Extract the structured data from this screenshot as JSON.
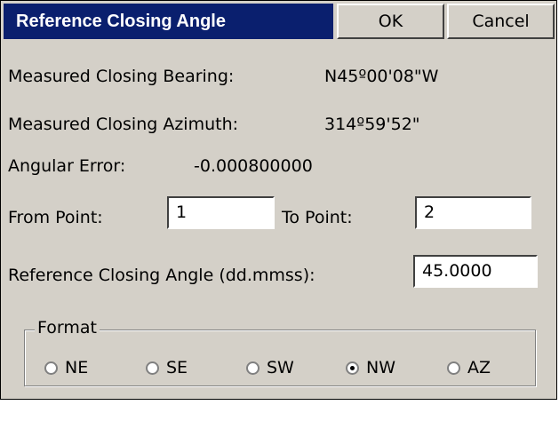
{
  "dialog": {
    "title": "Reference Closing Angle",
    "ok_label": "OK",
    "cancel_label": "Cancel"
  },
  "measured_bearing": {
    "label": "Measured Closing Bearing:",
    "value": "N45º00'08\"W"
  },
  "measured_azimuth": {
    "label": "Measured Closing Azimuth:",
    "value": "314º59'52\""
  },
  "angular_error": {
    "label": "Angular Error:",
    "value": "-0.000800000"
  },
  "from_point": {
    "label": "From Point:",
    "value": "1"
  },
  "to_point": {
    "label": "To Point:",
    "value": "2"
  },
  "reference_angle": {
    "label": "Reference Closing Angle (dd.mmss):",
    "value": "45.0000"
  },
  "format": {
    "legend": "Format",
    "options": [
      {
        "label": "NE",
        "checked": false
      },
      {
        "label": "SE",
        "checked": false
      },
      {
        "label": "SW",
        "checked": false
      },
      {
        "label": "NW",
        "checked": true
      },
      {
        "label": "AZ",
        "checked": false
      }
    ]
  }
}
